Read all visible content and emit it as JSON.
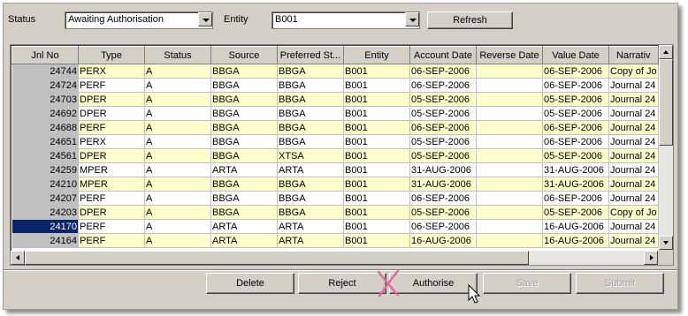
{
  "filters": {
    "status_label": "Status",
    "status_value": "Awaiting Authorisation",
    "entity_label": "Entity",
    "entity_value": "B001",
    "refresh_label": "Refresh"
  },
  "grid": {
    "columns": [
      "Jnl No",
      "Type",
      "Status",
      "Source",
      "Preferred St...",
      "Entity",
      "Account Date",
      "Reverse Date",
      "Value Date",
      "Narrativ"
    ],
    "rows": [
      [
        "24744",
        "PERX",
        "A",
        "BBGA",
        "BBGA",
        "B001",
        "06-SEP-2006",
        "",
        "06-SEP-2006",
        "Copy of Jo"
      ],
      [
        "24724",
        "PERF",
        "A",
        "BBGA",
        "BBGA",
        "B001",
        "06-SEP-2006",
        "",
        "06-SEP-2006",
        "Journal 24"
      ],
      [
        "24703",
        "DPER",
        "A",
        "BBGA",
        "BBGA",
        "B001",
        "05-SEP-2006",
        "",
        "05-SEP-2006",
        "Journal 24"
      ],
      [
        "24692",
        "DPER",
        "A",
        "BBGA",
        "BBGA",
        "B001",
        "05-SEP-2006",
        "",
        "05-SEP-2006",
        "Journal 24"
      ],
      [
        "24688",
        "PERF",
        "A",
        "BBGA",
        "BBGA",
        "B001",
        "06-SEP-2006",
        "",
        "06-SEP-2006",
        "Journal 24"
      ],
      [
        "24651",
        "PERX",
        "A",
        "BBGA",
        "BBGA",
        "B001",
        "05-SEP-2006",
        "",
        "06-SEP-2006",
        "Journal 24"
      ],
      [
        "24561",
        "DPER",
        "A",
        "BBGA",
        "XTSA",
        "B001",
        "05-SEP-2006",
        "",
        "05-SEP-2006",
        "Journal 24"
      ],
      [
        "24259",
        "MPER",
        "A",
        "ARTA",
        "ARTA",
        "B001",
        "31-AUG-2006",
        "",
        "31-AUG-2006",
        "Journal 24"
      ],
      [
        "24210",
        "MPER",
        "A",
        "BBGA",
        "BBGA",
        "B001",
        "31-AUG-2006",
        "",
        "31-AUG-2006",
        "Journal 24"
      ],
      [
        "24207",
        "PERF",
        "A",
        "BBGA",
        "BBGA",
        "B001",
        "06-SEP-2006",
        "",
        "06-SEP-2006",
        "Journal 24"
      ],
      [
        "24203",
        "DPER",
        "A",
        "BBGA",
        "BBGA",
        "B001",
        "05-SEP-2006",
        "",
        "05-SEP-2006",
        "Copy of Jo"
      ],
      [
        "24170",
        "PERF",
        "A",
        "ARTA",
        "ARTA",
        "B001",
        "06-SEP-2006",
        "",
        "16-AUG-2006",
        "Journal 24"
      ],
      [
        "24164",
        "PERF",
        "A",
        "ARTA",
        "ARTA",
        "B001",
        "16-AUG-2006",
        "",
        "16-AUG-2006",
        "Journal 24"
      ]
    ],
    "selected_row": 11
  },
  "actions": {
    "delete_label": "Delete",
    "reject_label": "Reject",
    "authorise_label": "Authorise",
    "save_label": "Save",
    "submit_label": "Submit"
  },
  "colors": {
    "row_alt": "#ffffcc",
    "selection": "#0a246a",
    "annotation_x": "#e06aa0"
  }
}
